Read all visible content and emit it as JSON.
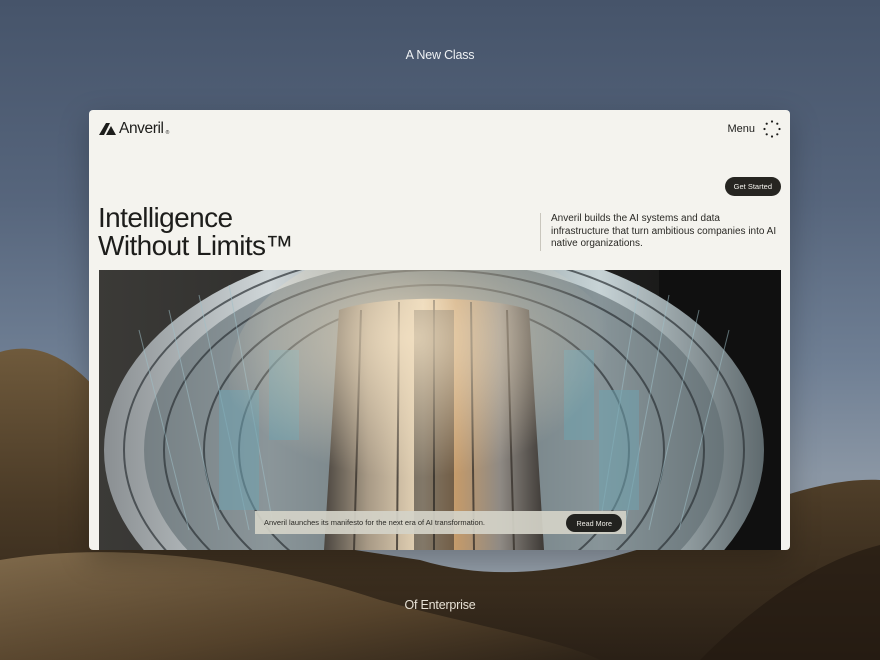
{
  "scene": {
    "top_caption": "A New Class",
    "bottom_caption": "Of Enterprise"
  },
  "nav": {
    "brand": "Anveril",
    "brand_mark": "®",
    "menu_label": "Menu",
    "menu_icon": "dots-circle-icon"
  },
  "hero": {
    "cta_label": "Get Started",
    "headline_line1": "Intelligence",
    "headline_line2": "Without Limits™",
    "intro_text": "Anveril builds the AI systems and data infrastructure that turn ambitious companies into AI native organizations.",
    "image_subject": "reactor-chamber-image"
  },
  "banner": {
    "text": "Anveril launches its manifesto for the next era of AI transformation.",
    "button_label": "Read More"
  },
  "colors": {
    "card_background": "#f4f3ee",
    "ink": "#1d1d1b",
    "button_dark": "#262521"
  }
}
